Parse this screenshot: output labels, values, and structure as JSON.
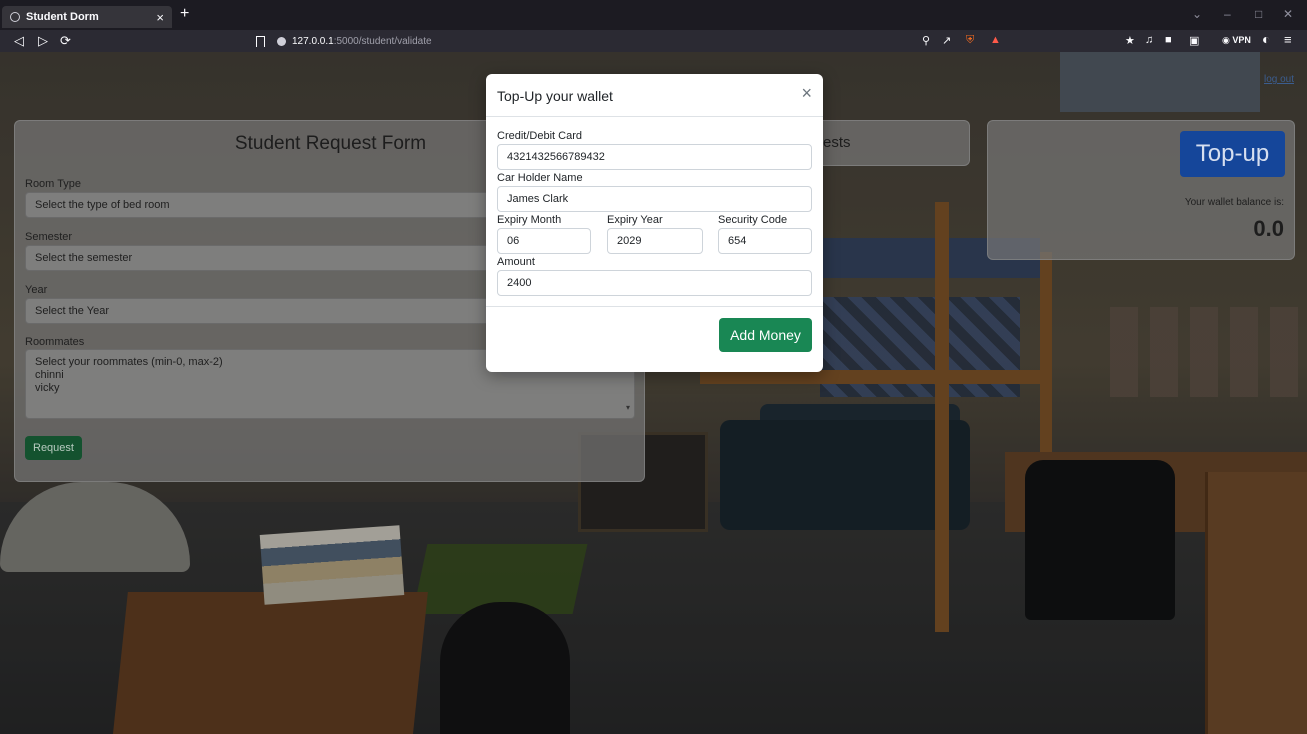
{
  "browser": {
    "tab_title": "Student Dorm",
    "tab_close": "×",
    "new_tab": "+",
    "url_host": "127.0.0.1",
    "url_path": ":5000/student/validate",
    "vpn_label": "VPN"
  },
  "page": {
    "logout_label": "log out"
  },
  "request_form": {
    "title": "Student Request Form",
    "room_type_label": "Room Type",
    "room_type_value": "Select the type of bed room",
    "semester_label": "Semester",
    "semester_value": "Select the semester",
    "year_label": "Year",
    "year_value": "Select the Year",
    "roommates_label": "Roommates",
    "roommates_options": [
      "Select your roommates (min-0, max-2)",
      "chinni",
      "vicky"
    ],
    "request_button": "Request"
  },
  "requests_card": {
    "title_fragment": "ests"
  },
  "wallet": {
    "topup_button": "Top-up",
    "balance_label": "Your wallet balance is:",
    "balance_value": "0.0"
  },
  "modal": {
    "title": "Top-Up your wallet",
    "close": "×",
    "card_label": "Credit/Debit Card",
    "card_value": "4321432566789432",
    "holder_label": "Car Holder Name",
    "holder_value": "James Clark",
    "month_label": "Expiry Month",
    "month_value": "06",
    "year_label": "Expiry Year",
    "year_value": "2029",
    "code_label": "Security Code",
    "code_value": "654",
    "amount_label": "Amount",
    "amount_value": "2400",
    "submit_button": "Add Money"
  },
  "colors": {
    "add_money": "#198754",
    "topup": "#15469a",
    "request": "#14522f"
  }
}
